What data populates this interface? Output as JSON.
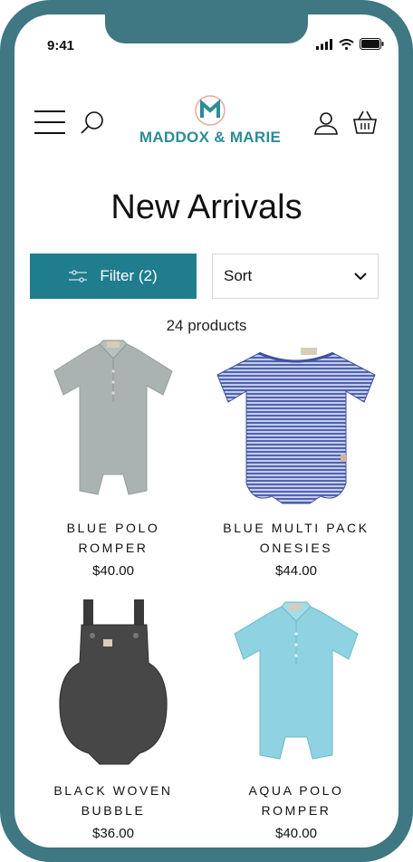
{
  "status_bar": {
    "time": "9:41"
  },
  "brand": {
    "name": "MADDOX & MARIE",
    "logo_letter": "M",
    "color": "#2b8c96"
  },
  "header": {
    "menu_icon": "hamburger-menu-icon",
    "search_icon": "search-icon",
    "account_icon": "user-icon",
    "cart_icon": "basket-icon"
  },
  "page": {
    "title": "New Arrivals"
  },
  "toolbar": {
    "filter_label": "Filter (2)",
    "sort_label": "Sort",
    "filter_color": "#1f7d8e"
  },
  "results": {
    "count_label": "24 products"
  },
  "products": [
    {
      "name_line1": "BLUE POLO",
      "name_line2": "ROMPER",
      "price": "$40.00",
      "image": "grey-polo-romper"
    },
    {
      "name_line1": "BLUE MULTI PACK",
      "name_line2": "ONESIES",
      "price": "$44.00",
      "image": "blue-striped-onesie"
    },
    {
      "name_line1": "BLACK WOVEN",
      "name_line2": "BUBBLE",
      "price": "$36.00",
      "image": "black-overall-bubble"
    },
    {
      "name_line1": "AQUA POLO",
      "name_line2": "ROMPER",
      "price": "$40.00",
      "image": "aqua-polo-romper"
    }
  ],
  "colors": {
    "frame": "#3f7782",
    "accent": "#1f7d8e"
  }
}
